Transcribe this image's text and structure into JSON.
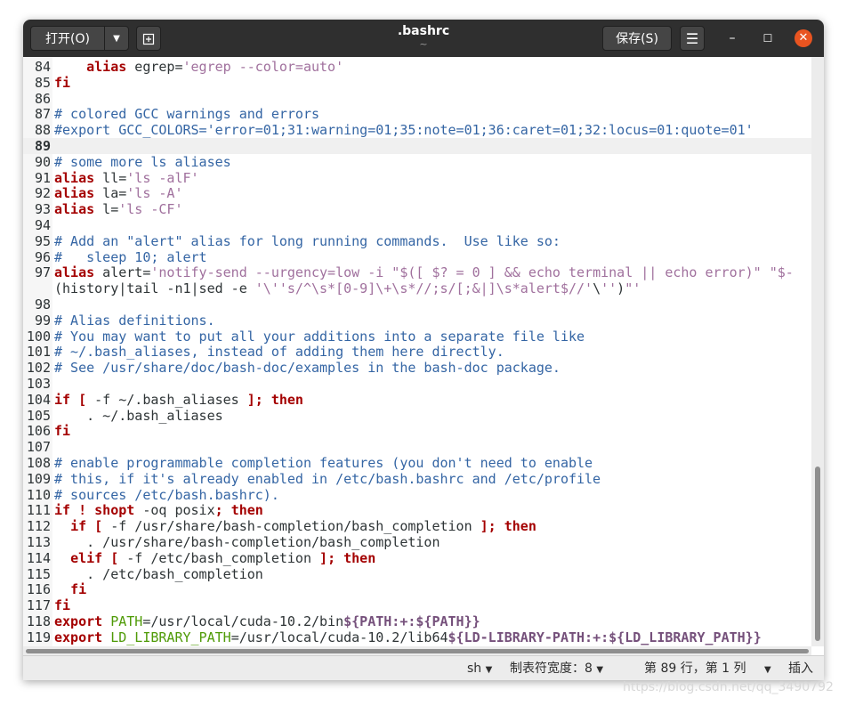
{
  "window": {
    "title": ".bashrc",
    "subtitle": "~",
    "open_label": "打开(O)",
    "open_dropdown_icon": "chevron-down-icon",
    "new_tab_icon": "new-tab-icon",
    "save_label": "保存(S)",
    "menu_icon": "hamburger-menu-icon",
    "minimize_icon": "minimize-icon",
    "maximize_icon": "maximize-icon",
    "close_icon": "close-icon",
    "close_color": "#e95420"
  },
  "editor": {
    "current_line": 89,
    "lines": [
      {
        "n": "84",
        "t": "    alias egrep='egrep --color=auto'"
      },
      {
        "n": "85",
        "t": "fi"
      },
      {
        "n": "86",
        "t": ""
      },
      {
        "n": "87",
        "t": "# colored GCC warnings and errors"
      },
      {
        "n": "88",
        "t": "#export GCC_COLORS='error=01;31:warning=01;35:note=01;36:caret=01;32:locus=01:quote=01'"
      },
      {
        "n": "89",
        "t": ""
      },
      {
        "n": "90",
        "t": "# some more ls aliases"
      },
      {
        "n": "91",
        "t": "alias ll='ls -alF'"
      },
      {
        "n": "92",
        "t": "alias la='ls -A'"
      },
      {
        "n": "93",
        "t": "alias l='ls -CF'"
      },
      {
        "n": "94",
        "t": ""
      },
      {
        "n": "95",
        "t": "# Add an \"alert\" alias for long running commands.  Use like so:"
      },
      {
        "n": "96",
        "t": "#   sleep 10; alert"
      },
      {
        "n": "97",
        "t": "alias alert='notify-send --urgency=low -i \"$([ $? = 0 ] && echo terminal || echo error)\" \"$-"
      },
      {
        "n": "",
        "t": "(history|tail -n1|sed -e '\\''s/^\\s*[0-9]\\+\\s*//;s/[;&|]\\s*alert$//'\\'')\"'"
      },
      {
        "n": "98",
        "t": ""
      },
      {
        "n": "99",
        "t": "# Alias definitions."
      },
      {
        "n": "100",
        "t": "# You may want to put all your additions into a separate file like"
      },
      {
        "n": "101",
        "t": "# ~/.bash_aliases, instead of adding them here directly."
      },
      {
        "n": "102",
        "t": "# See /usr/share/doc/bash-doc/examples in the bash-doc package."
      },
      {
        "n": "103",
        "t": ""
      },
      {
        "n": "104",
        "t": "if [ -f ~/.bash_aliases ]; then"
      },
      {
        "n": "105",
        "t": "    . ~/.bash_aliases"
      },
      {
        "n": "106",
        "t": "fi"
      },
      {
        "n": "107",
        "t": ""
      },
      {
        "n": "108",
        "t": "# enable programmable completion features (you don't need to enable"
      },
      {
        "n": "109",
        "t": "# this, if it's already enabled in /etc/bash.bashrc and /etc/profile"
      },
      {
        "n": "110",
        "t": "# sources /etc/bash.bashrc)."
      },
      {
        "n": "111",
        "t": "if ! shopt -oq posix; then"
      },
      {
        "n": "112",
        "t": "  if [ -f /usr/share/bash-completion/bash_completion ]; then"
      },
      {
        "n": "113",
        "t": "    . /usr/share/bash-completion/bash_completion"
      },
      {
        "n": "114",
        "t": "  elif [ -f /etc/bash_completion ]; then"
      },
      {
        "n": "115",
        "t": "    . /etc/bash_completion"
      },
      {
        "n": "116",
        "t": "  fi"
      },
      {
        "n": "117",
        "t": "fi"
      },
      {
        "n": "118",
        "t": "export PATH=/usr/local/cuda-10.2/bin${PATH:+:${PATH}}"
      },
      {
        "n": "119",
        "t": "export LD_LIBRARY_PATH=/usr/local/cuda-10.2/lib64${LD-LIBRARY-PATH:+:${LD_LIBRARY_PATH}}"
      }
    ]
  },
  "status": {
    "language": "sh",
    "tab_width": "制表符宽度：8",
    "position": "第 89 行，第 1 列",
    "insert_mode": "插入",
    "dropdown_icon": "triangle-down-icon"
  },
  "watermark": "https://blog.csdn.net/qq_3490792"
}
